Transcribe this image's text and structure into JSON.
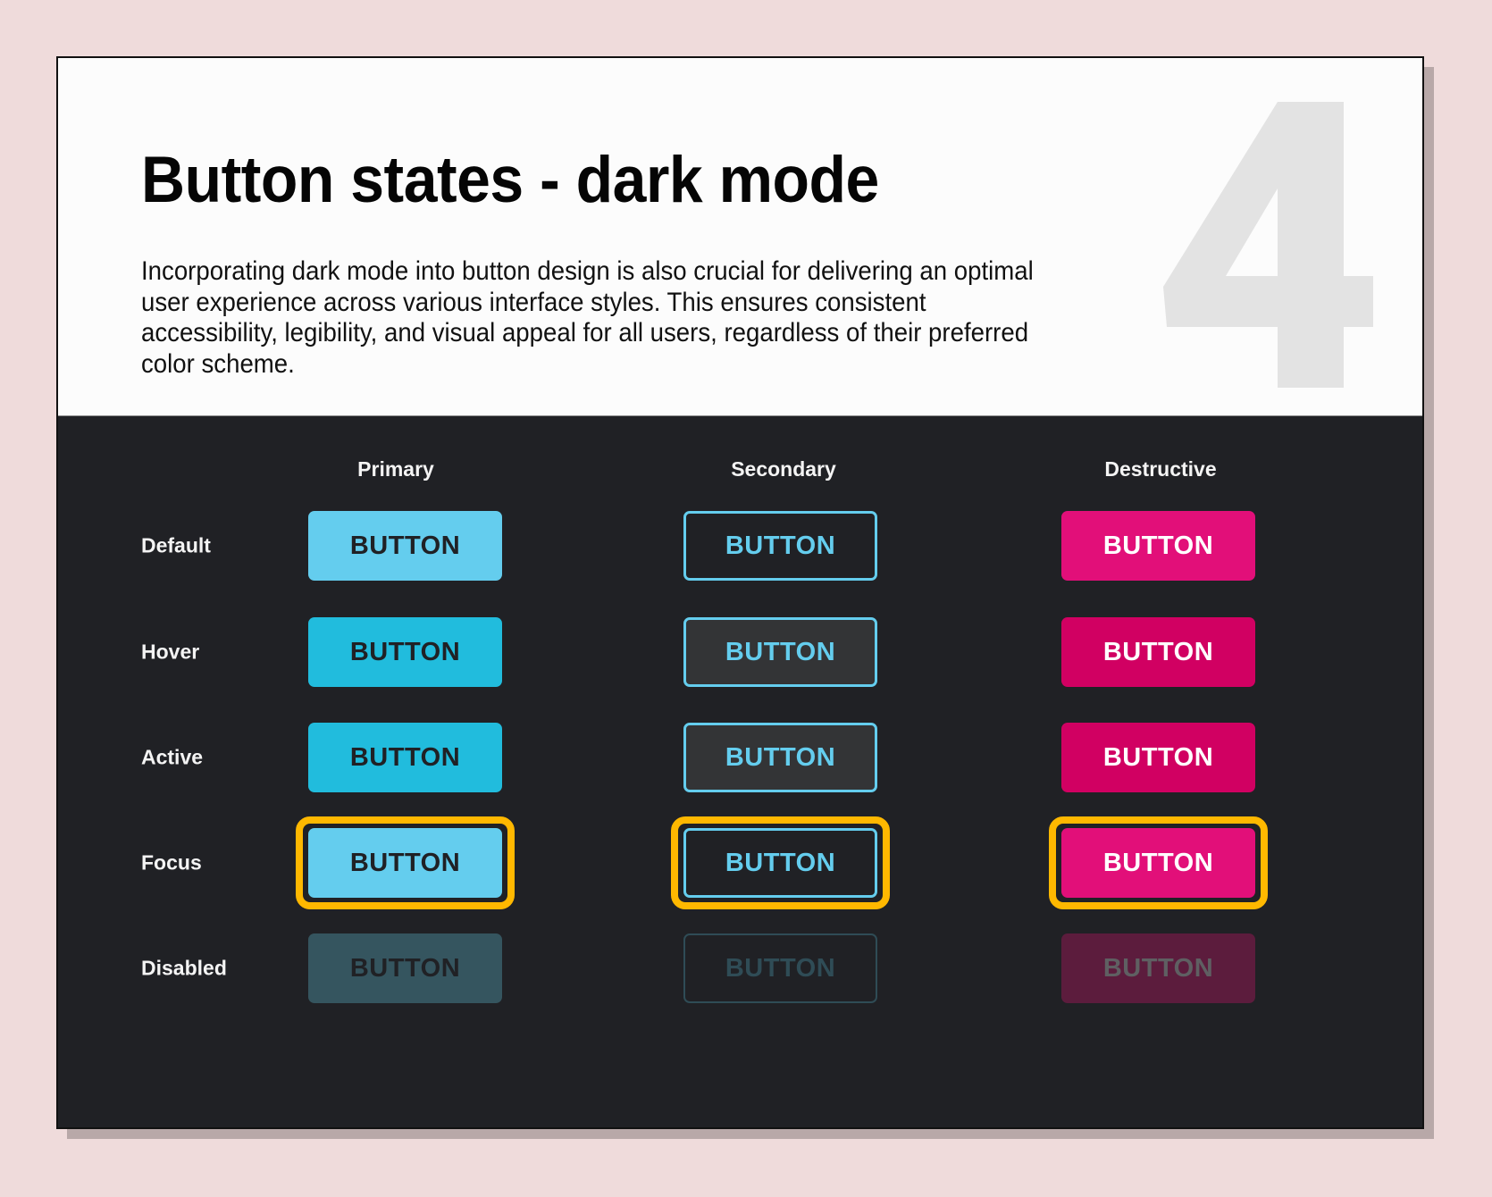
{
  "page": {
    "section_number": "4",
    "title": "Button states - dark mode",
    "description": "Incorporating dark mode into button design is also crucial for delivering an optimal user experience across various interface styles. This ensures consistent accessibility, legibility, and visual appeal for all users, regardless of their preferred color scheme."
  },
  "columns": [
    "Primary",
    "Secondary",
    "Destructive"
  ],
  "rows": [
    "Default",
    "Hover",
    "Active",
    "Focus",
    "Disabled"
  ],
  "button_label": "BUTTON",
  "colors": {
    "background": "#efdbdb",
    "panel": "#202125",
    "primary": "#64cdee",
    "primary_hover": "#21bcdd",
    "primary_disabled": "#35555f",
    "secondary_hover_fill": "#333436",
    "secondary_disabled_border": "#2f4c56",
    "destructive": "#e20f79",
    "destructive_hover": "#d10062",
    "destructive_disabled": "#5c1c3d",
    "focus_ring": "#ffb800",
    "watermark": "#e3e3e3"
  }
}
